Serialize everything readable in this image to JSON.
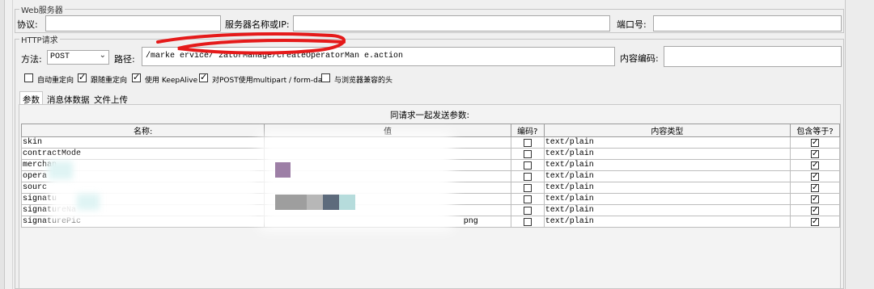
{
  "web_server": {
    "legend": "Web服务器",
    "protocol_label": "协议:",
    "protocol_value": "",
    "server_label": "服务器名称或IP:",
    "server_value": "",
    "port_label": "端口号:",
    "port_value": ""
  },
  "http_request": {
    "legend": "HTTP请求",
    "method_label": "方法:",
    "method_value": "POST",
    "path_label": "路径:",
    "path_value": "/marke        ervice/ zatorManage/createOperatorMan   e.action",
    "encoding_label": "内容编码:",
    "encoding_value": "",
    "options": [
      {
        "label": "自动重定向",
        "checked": false
      },
      {
        "label": "跟随重定向",
        "checked": true
      },
      {
        "label": "使用 KeepAlive",
        "checked": true
      },
      {
        "label": "对POST使用multipart / form-data",
        "checked": true
      },
      {
        "label": "与浏览器兼容的头",
        "checked": false
      }
    ]
  },
  "tabs": [
    {
      "label": "参数",
      "active": true
    },
    {
      "label": "消息体数据",
      "active": false
    },
    {
      "label": "文件上传",
      "active": false
    }
  ],
  "params_table": {
    "title": "同请求一起发送参数:",
    "columns": [
      "名称:",
      "值",
      "编码?",
      "内容类型",
      "包含等于?"
    ],
    "rows": [
      {
        "name": "skin",
        "value": "",
        "encode": false,
        "content_type": "text/plain",
        "include_equals": true
      },
      {
        "name": "contractMode",
        "value": "",
        "encode": false,
        "content_type": "text/plain",
        "include_equals": true
      },
      {
        "name": "merchan",
        "value": "",
        "encode": false,
        "content_type": "text/plain",
        "include_equals": true
      },
      {
        "name": "opera",
        "value": "",
        "encode": false,
        "content_type": "text/plain",
        "include_equals": true
      },
      {
        "name": "sourc",
        "value": "",
        "encode": false,
        "content_type": "text/plain",
        "include_equals": true
      },
      {
        "name": "signatu",
        "value": "",
        "encode": false,
        "content_type": "text/plain",
        "include_equals": true
      },
      {
        "name": "signatureNa",
        "value": "",
        "encode": false,
        "content_type": "text/plain",
        "include_equals": true
      },
      {
        "name": "signaturePic",
        "value": "png",
        "encode": false,
        "content_type": "text/plain",
        "include_equals": true
      }
    ]
  },
  "colors": {
    "redact_red": "#e51a1a",
    "blur_purple": "#9d7fa6",
    "blur_gray": "#9e9e9e",
    "blur_slate": "#5d6b7c",
    "blur_teal": "#b6dcdc"
  }
}
